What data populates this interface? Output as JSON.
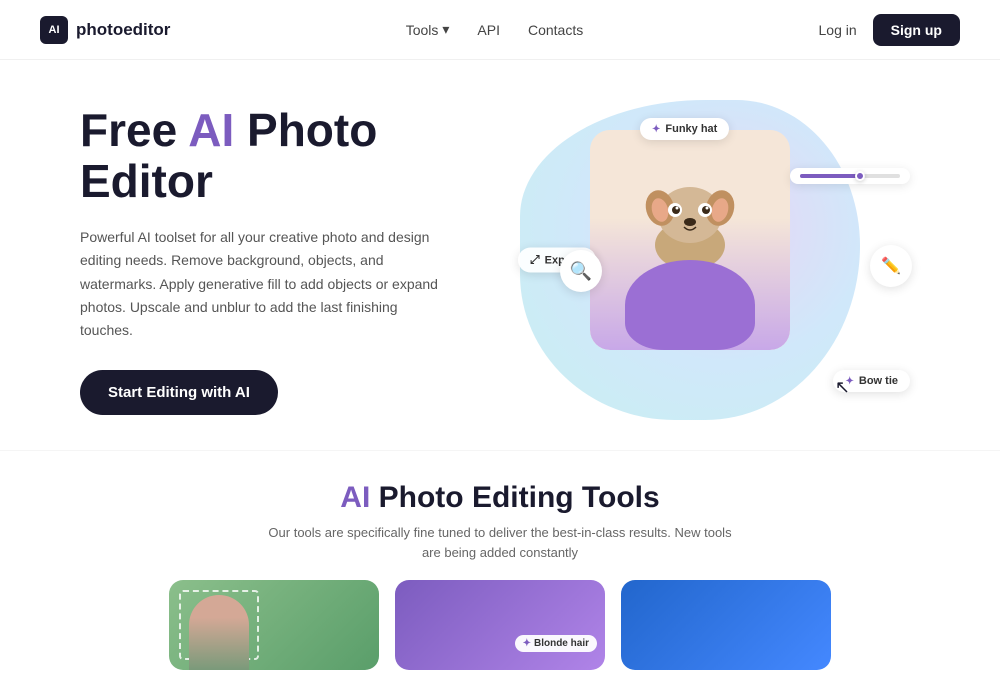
{
  "nav": {
    "logo_text": "photoeditor",
    "logo_icon_text": "AI",
    "links": [
      {
        "label": "Tools",
        "has_dropdown": true
      },
      {
        "label": "API"
      },
      {
        "label": "Contacts"
      }
    ],
    "login_label": "Log in",
    "signup_label": "Sign up"
  },
  "hero": {
    "title_free": "Free ",
    "title_ai": "AI",
    "title_rest": " Photo Editor",
    "description": "Powerful AI toolset for all your creative photo and design editing needs. Remove background, objects, and watermarks. Apply generative fill to add objects or expand photos. Upscale and unblur to add the last finishing touches.",
    "cta_label": "Start Editing with AI",
    "chip_funky": "Funky hat",
    "chip_expand": "Expand",
    "chip_bowtie": "Bow tie"
  },
  "tools_section": {
    "title_ai": "AI",
    "title_rest": " Photo Editing Tools",
    "subtitle_line1": "Our tools are specifically fine tuned to deliver the best-in-class results. New tools",
    "subtitle_line2": "are being added constantly",
    "card2_chip": "Blonde hair"
  }
}
